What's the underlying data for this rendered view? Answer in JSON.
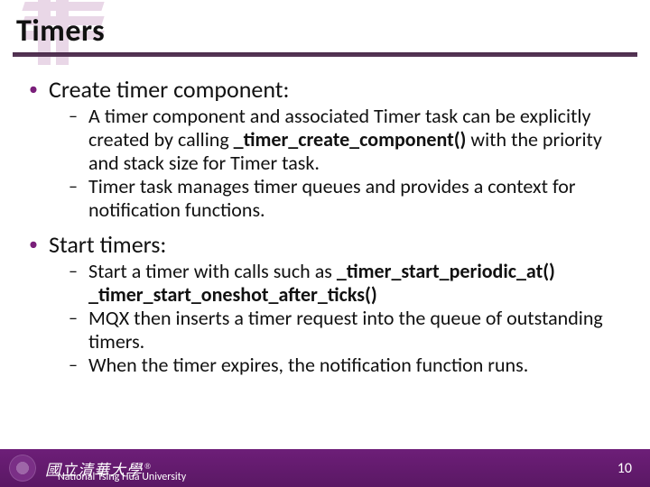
{
  "slide": {
    "title": "Timers",
    "page_number": "10"
  },
  "content": {
    "item1": {
      "label": "Create timer component:",
      "sub1_a": "A timer component and associated Timer task can be explicitly created by calling ",
      "sub1_fn": "_timer_create_component()",
      "sub1_b": " with the priority and stack size for Timer task.",
      "sub2": "Timer task manages timer queues and provides a context for notification functions."
    },
    "item2": {
      "label": "Start timers:",
      "sub1_a": "Start a timer with calls such as ",
      "sub1_fn1": "_timer_start_periodic_at()",
      "sub1_mid": " ",
      "sub1_fn2": "_timer_start_oneshot_after_ticks()",
      "sub2": "MQX then inserts a timer request into the queue of outstanding timers.",
      "sub3": "When the timer expires, the notification function runs."
    }
  },
  "footer": {
    "calligraphy": "國立清華大學",
    "university": "National Tsing Hua University"
  }
}
